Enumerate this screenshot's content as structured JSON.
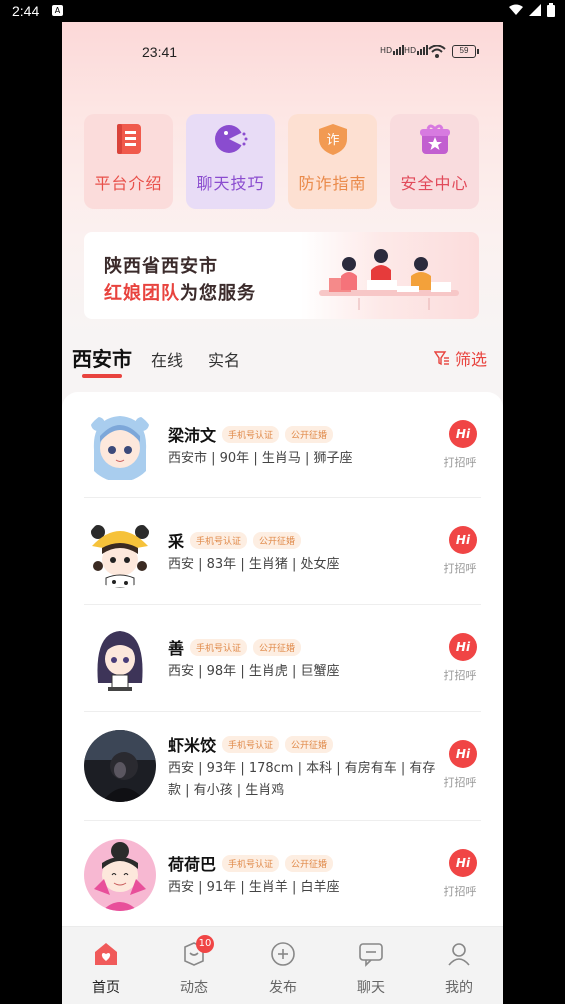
{
  "system_status": {
    "time": "2:44",
    "app_badge": "A"
  },
  "inner_status": {
    "time": "23:41",
    "sim1": "HD",
    "sim2": "HD",
    "battery": "59"
  },
  "tiles": [
    {
      "label": "平台介绍",
      "icon": "book-icon"
    },
    {
      "label": "聊天技巧",
      "icon": "chat-bubble-icon"
    },
    {
      "label": "防诈指南",
      "icon": "shield-icon"
    },
    {
      "label": "安全中心",
      "icon": "gift-box-icon"
    }
  ],
  "banner": {
    "line1": "陕西省西安市",
    "line2_highlight": "红娘团队",
    "line2_rest": "为您服务"
  },
  "tabs": {
    "active": "西安市",
    "tab2": "在线",
    "tab3": "实名",
    "filter": "筛选"
  },
  "badges": {
    "phone": "手机号认证",
    "public": "公开征婚"
  },
  "hi": {
    "button": "Hi",
    "label": "打招呼"
  },
  "profiles": [
    {
      "name": "梁沛文",
      "desc": "西安市 | 90年 | 生肖马 | 狮子座"
    },
    {
      "name": "采",
      "desc": "西安 | 83年 | 生肖猪 | 处女座"
    },
    {
      "name": "善",
      "desc": "西安 | 98年 | 生肖虎 | 巨蟹座"
    },
    {
      "name": "虾米饺",
      "desc": "西安 | 93年 | 178cm | 本科 | 有房有车 | 有存款 | 有小孩 | 生肖鸡"
    },
    {
      "name": "荷荷巴",
      "desc": "西安 | 91年 | 生肖羊 | 白羊座"
    }
  ],
  "nav": [
    {
      "label": "首页",
      "icon": "home-icon"
    },
    {
      "label": "动态",
      "icon": "moments-icon",
      "badge": "10"
    },
    {
      "label": "发布",
      "icon": "plus-icon"
    },
    {
      "label": "聊天",
      "icon": "message-icon"
    },
    {
      "label": "我的",
      "icon": "person-icon"
    }
  ]
}
